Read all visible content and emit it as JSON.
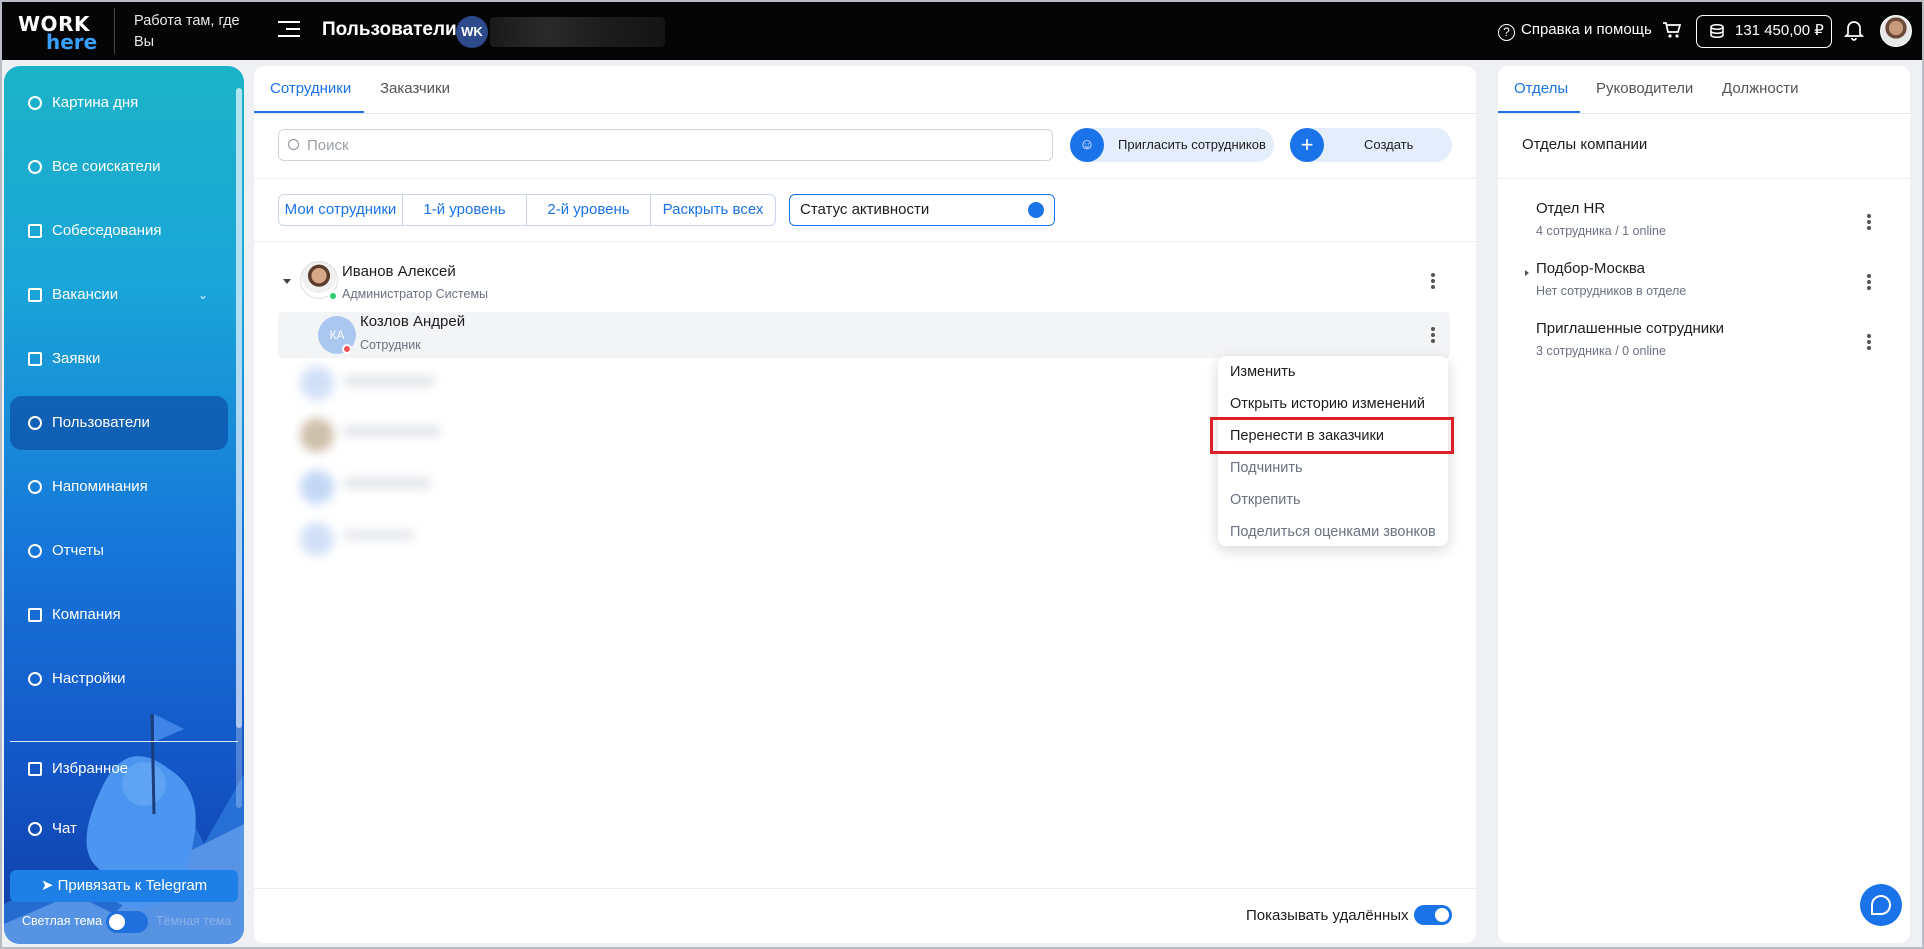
{
  "header": {
    "logo_top": "WORK",
    "logo_bottom": "here",
    "slogan": "Работа там, где Вы",
    "page_title": "Пользователи",
    "org_initials": "WK",
    "help_label": "Справка и помощь",
    "balance": "131 450,00 ₽"
  },
  "sidebar": {
    "items": [
      {
        "label": "Картина дня",
        "icon": "rocket-icon"
      },
      {
        "label": "Все соискатели",
        "icon": "people-icon"
      },
      {
        "label": "Собеседования",
        "icon": "calendar-icon"
      },
      {
        "label": "Вакансии",
        "icon": "briefcase-icon"
      },
      {
        "label": "Заявки",
        "icon": "list-icon"
      },
      {
        "label": "Пользователи",
        "icon": "user-circle-icon"
      },
      {
        "label": "Напоминания",
        "icon": "timer-icon"
      },
      {
        "label": "Отчеты",
        "icon": "pie-icon"
      },
      {
        "label": "Компания",
        "icon": "home-icon"
      },
      {
        "label": "Настройки",
        "icon": "gear-icon"
      },
      {
        "label": "Избранное",
        "icon": "grid-icon"
      },
      {
        "label": "Чат",
        "icon": "chat-icon"
      }
    ],
    "telegram_button": "Привязать к Telegram",
    "light_theme": "Светлая тема",
    "dark_theme": "Тёмная тема"
  },
  "main": {
    "tabs": [
      "Сотрудники",
      "Заказчики"
    ],
    "search_placeholder": "Поиск",
    "invite_button": "Пригласить сотрудников",
    "create_button": "Создать",
    "filters": [
      "Мои сотрудники",
      "1-й уровень",
      "2-й уровень",
      "Раскрыть всех"
    ],
    "status_filter": "Статус активности",
    "employees": [
      {
        "name": "Иванов Алексей",
        "role": "Администратор Системы",
        "status_color": "#2ecc71"
      },
      {
        "name": "Козлов Андрей",
        "role": "Сотрудник",
        "initials": "КА",
        "status_color": "#f05454"
      }
    ],
    "context_menu": [
      "Изменить",
      "Открыть историю изменений",
      "Перенести в заказчики",
      "Подчинить",
      "Открепить",
      "Поделиться оценками звонков"
    ],
    "show_deleted": "Показывать удалённых",
    "show_deleted_on": true
  },
  "right": {
    "tabs": [
      "Отделы",
      "Руководители",
      "Должности"
    ],
    "title": "Отделы компании",
    "departments": [
      {
        "name": "Отдел HR",
        "info": "4 сотрудника / 1 online"
      },
      {
        "name": "Подбор-Москва",
        "info": "Нет сотрудников в отделе"
      },
      {
        "name": "Приглашенные сотрудники",
        "info": "3 сотрудника / 0 online"
      }
    ]
  },
  "colors": {
    "accent": "#1a73e8",
    "highlight": "#e11d25"
  }
}
